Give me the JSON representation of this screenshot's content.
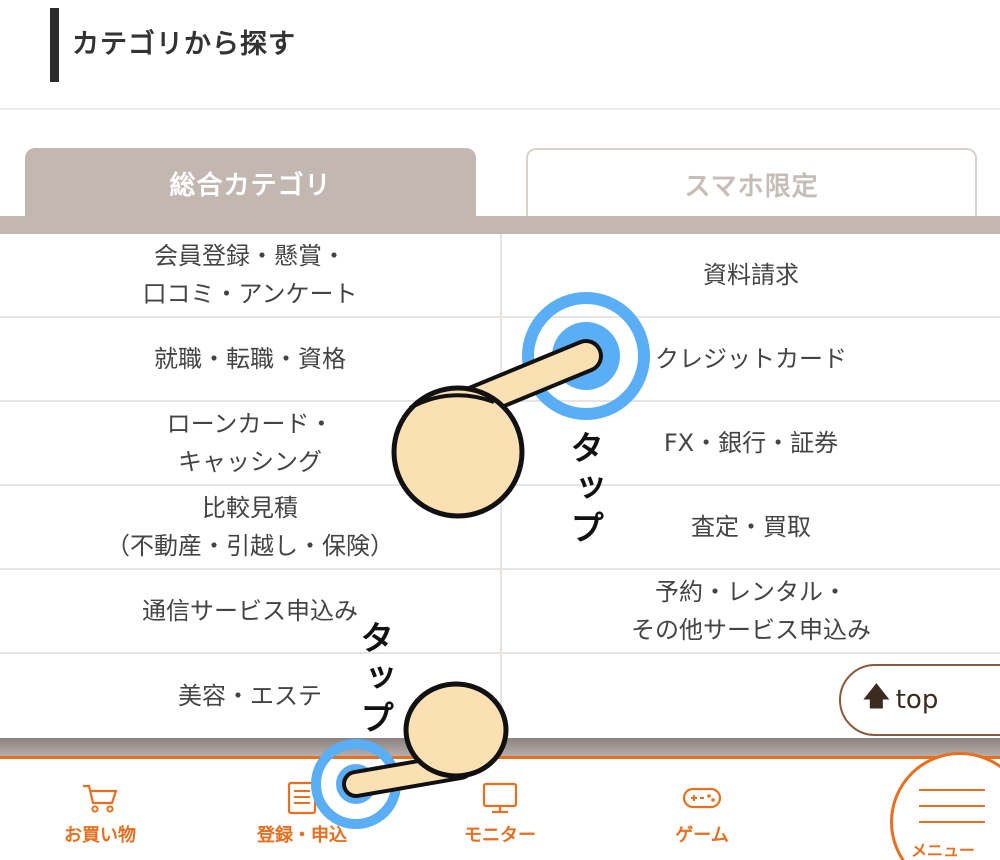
{
  "header": {
    "title": "カテゴリから探す"
  },
  "tabs": [
    {
      "label": "総合カテゴリ",
      "active": true
    },
    {
      "label": "スマホ限定",
      "active": false
    }
  ],
  "categories": {
    "left": [
      "会員登録・懸賞・\n口コミ・アンケート",
      "就職・転職・資格",
      "ローンカード・\nキャッシング",
      "比較見積\n（不動産・引越し・保険）",
      "通信サービス申込み",
      "美容・エステ"
    ],
    "right": [
      "資料請求",
      "クレジットカード",
      "FX・銀行・証券",
      "査定・買取",
      "予約・レンタル・\nその他サービス申込み"
    ]
  },
  "top_button": {
    "label": "top"
  },
  "bottom_nav": {
    "items": [
      {
        "label": "お買い物",
        "icon": "cart-icon"
      },
      {
        "label": "登録・申込",
        "icon": "form-icon"
      },
      {
        "label": "モニター",
        "icon": "monitor-icon"
      },
      {
        "label": "ゲーム",
        "icon": "gamepad-icon"
      }
    ],
    "menu_label": "メニュー"
  },
  "overlay": {
    "tap_label": "タップ"
  },
  "colors": {
    "accent": "#e86f1f",
    "tab_active": "#c3b8b1",
    "tap_ring": "#5aaef5",
    "hand": "#fbe0b4"
  }
}
